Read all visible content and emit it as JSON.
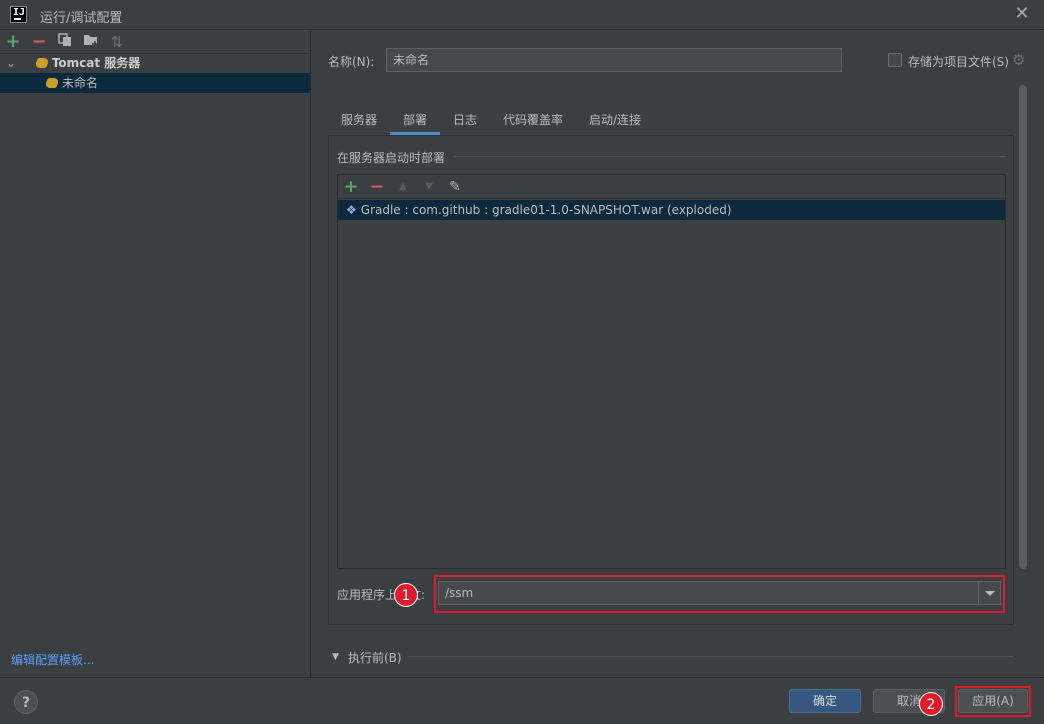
{
  "window": {
    "logo_text": "IJ",
    "title": "运行/调试配置"
  },
  "left": {
    "toolbar_icons": [
      "plus-icon",
      "minus-icon",
      "copy-icon",
      "folder-add-icon",
      "sort-icon"
    ],
    "tree": [
      {
        "label": "Tomcat 服务器",
        "expanded": true
      },
      {
        "label": "未命名",
        "selected": true
      }
    ],
    "edit_templates_link": "编辑配置模板..."
  },
  "right": {
    "name_label": "名称(N):",
    "name_value": "未命名",
    "store_as_project_file": "存储为项目文件(S)",
    "tabs": [
      {
        "label": "服务器"
      },
      {
        "label": "部署",
        "active": true
      },
      {
        "label": "日志"
      },
      {
        "label": "代码覆盖率"
      },
      {
        "label": "启动/连接"
      }
    ],
    "deploy_section_title": "在服务器启动时部署",
    "artifact_row": "Gradle : com.github : gradle01-1.0-SNAPSHOT.war (exploded)",
    "context_label": "应用程序上下文:",
    "context_value": "/ssm",
    "before_launch": "执行前(B)"
  },
  "annotations": {
    "badge_1": "1",
    "badge_2": "2",
    "color": "#e0192b"
  },
  "bottom": {
    "help": "?",
    "ok": "确定",
    "cancel": "取消",
    "apply": "应用(A)"
  }
}
